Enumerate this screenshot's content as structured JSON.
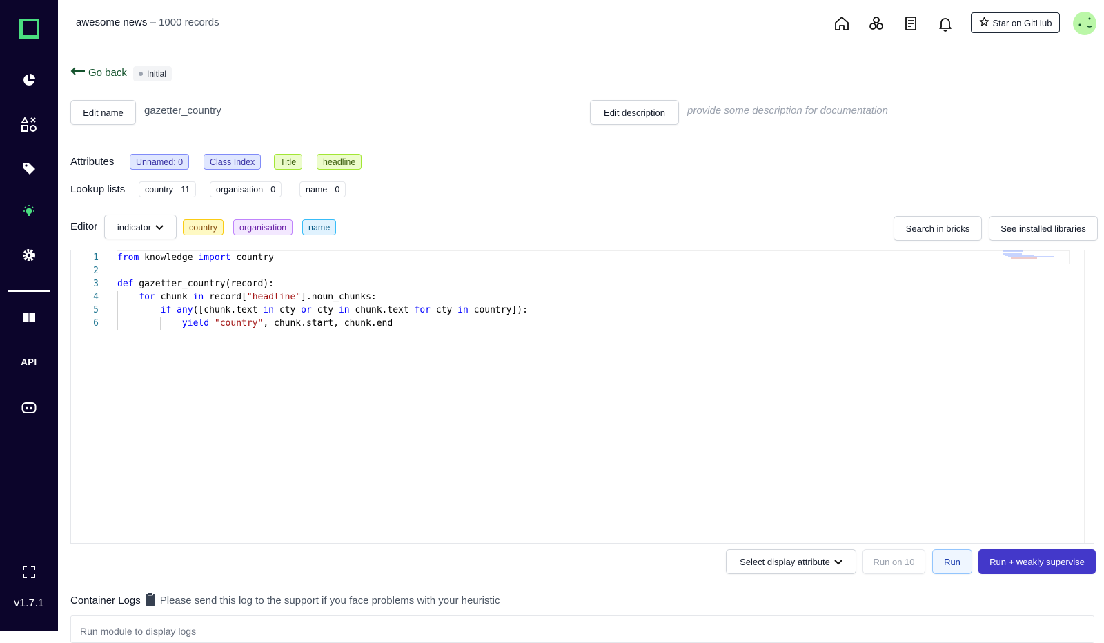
{
  "app": {
    "version": "v1.7.1",
    "sidebar_api_label": "API"
  },
  "header": {
    "project_name": "awesome news",
    "record_count": "– 1000 records",
    "github_button": "Star on GitHub"
  },
  "heuristic": {
    "go_back": "Go back",
    "status": "Initial",
    "edit_name_button": "Edit name",
    "name": "gazetter_country",
    "edit_description_button": "Edit description",
    "description_placeholder": "provide some description for documentation"
  },
  "attributes": {
    "label": "Attributes",
    "items": [
      "Unnamed: 0",
      "Class Index",
      "Title",
      "headline"
    ]
  },
  "lookup_lists": {
    "label": "Lookup lists",
    "items": [
      "country - 11",
      "organisation - 0",
      "name - 0"
    ]
  },
  "editor": {
    "label": "Editor",
    "labeling_task": "indicator",
    "labels": [
      "country",
      "organisation",
      "name"
    ],
    "search_bricks_button": "Search in bricks",
    "installed_libraries_button": "See installed libraries",
    "line_numbers": [
      "1",
      "2",
      "3",
      "4",
      "5",
      "6"
    ],
    "code_lines": [
      "from knowledge import country",
      "",
      "def gazetter_country(record):",
      "    for chunk in record[\"headline\"].noun_chunks:",
      "        if any([chunk.text in cty or cty in chunk.text for cty in country]):",
      "            yield \"country\", chunk.start, chunk.end"
    ]
  },
  "actions": {
    "display_attribute": "Select display attribute",
    "run_on_10": "Run on 10",
    "run": "Run",
    "run_weakly": "Run + weakly supervise"
  },
  "logs": {
    "label": "Container Logs",
    "hint": "Please send this log to the support if you face problems with your heuristic",
    "placeholder": "Run module to display logs"
  },
  "colors": {
    "sidebar_bg": "#0c052b",
    "brand_green": "#4ade80",
    "primary": "#4338ca"
  }
}
